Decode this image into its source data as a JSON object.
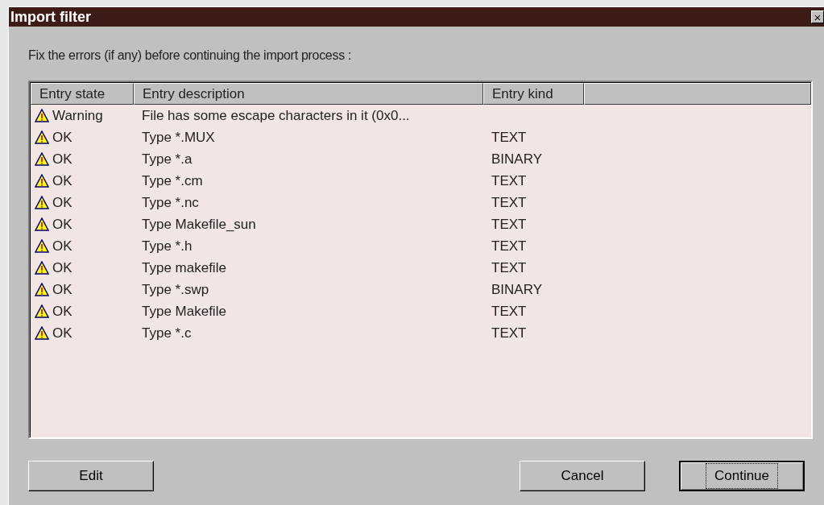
{
  "window": {
    "title": "Import filter",
    "close": "×"
  },
  "instruction": "Fix the errors (if any) before continuing the import process :",
  "table": {
    "columns": [
      "Entry state",
      "Entry description",
      "Entry kind"
    ],
    "rows": [
      {
        "state": "Warning",
        "description": "File has some escape characters in it (0x0...",
        "kind": ""
      },
      {
        "state": "OK",
        "description": "Type *.MUX",
        "kind": "TEXT"
      },
      {
        "state": "OK",
        "description": "Type *.a",
        "kind": "BINARY"
      },
      {
        "state": "OK",
        "description": "Type *.cm",
        "kind": "TEXT"
      },
      {
        "state": "OK",
        "description": "Type *.nc",
        "kind": "TEXT"
      },
      {
        "state": "OK",
        "description": "Type Makefile_sun",
        "kind": "TEXT"
      },
      {
        "state": "OK",
        "description": "Type *.h",
        "kind": "TEXT"
      },
      {
        "state": "OK",
        "description": "Type makefile",
        "kind": "TEXT"
      },
      {
        "state": "OK",
        "description": "Type *.swp",
        "kind": "BINARY"
      },
      {
        "state": "OK",
        "description": "Type Makefile",
        "kind": "TEXT"
      },
      {
        "state": "OK",
        "description": "Type *.c",
        "kind": "TEXT"
      }
    ]
  },
  "buttons": [
    {
      "label": "Edit",
      "default": false
    },
    {
      "label": "Cancel",
      "default": false
    },
    {
      "label": "Continue",
      "default": true
    }
  ]
}
